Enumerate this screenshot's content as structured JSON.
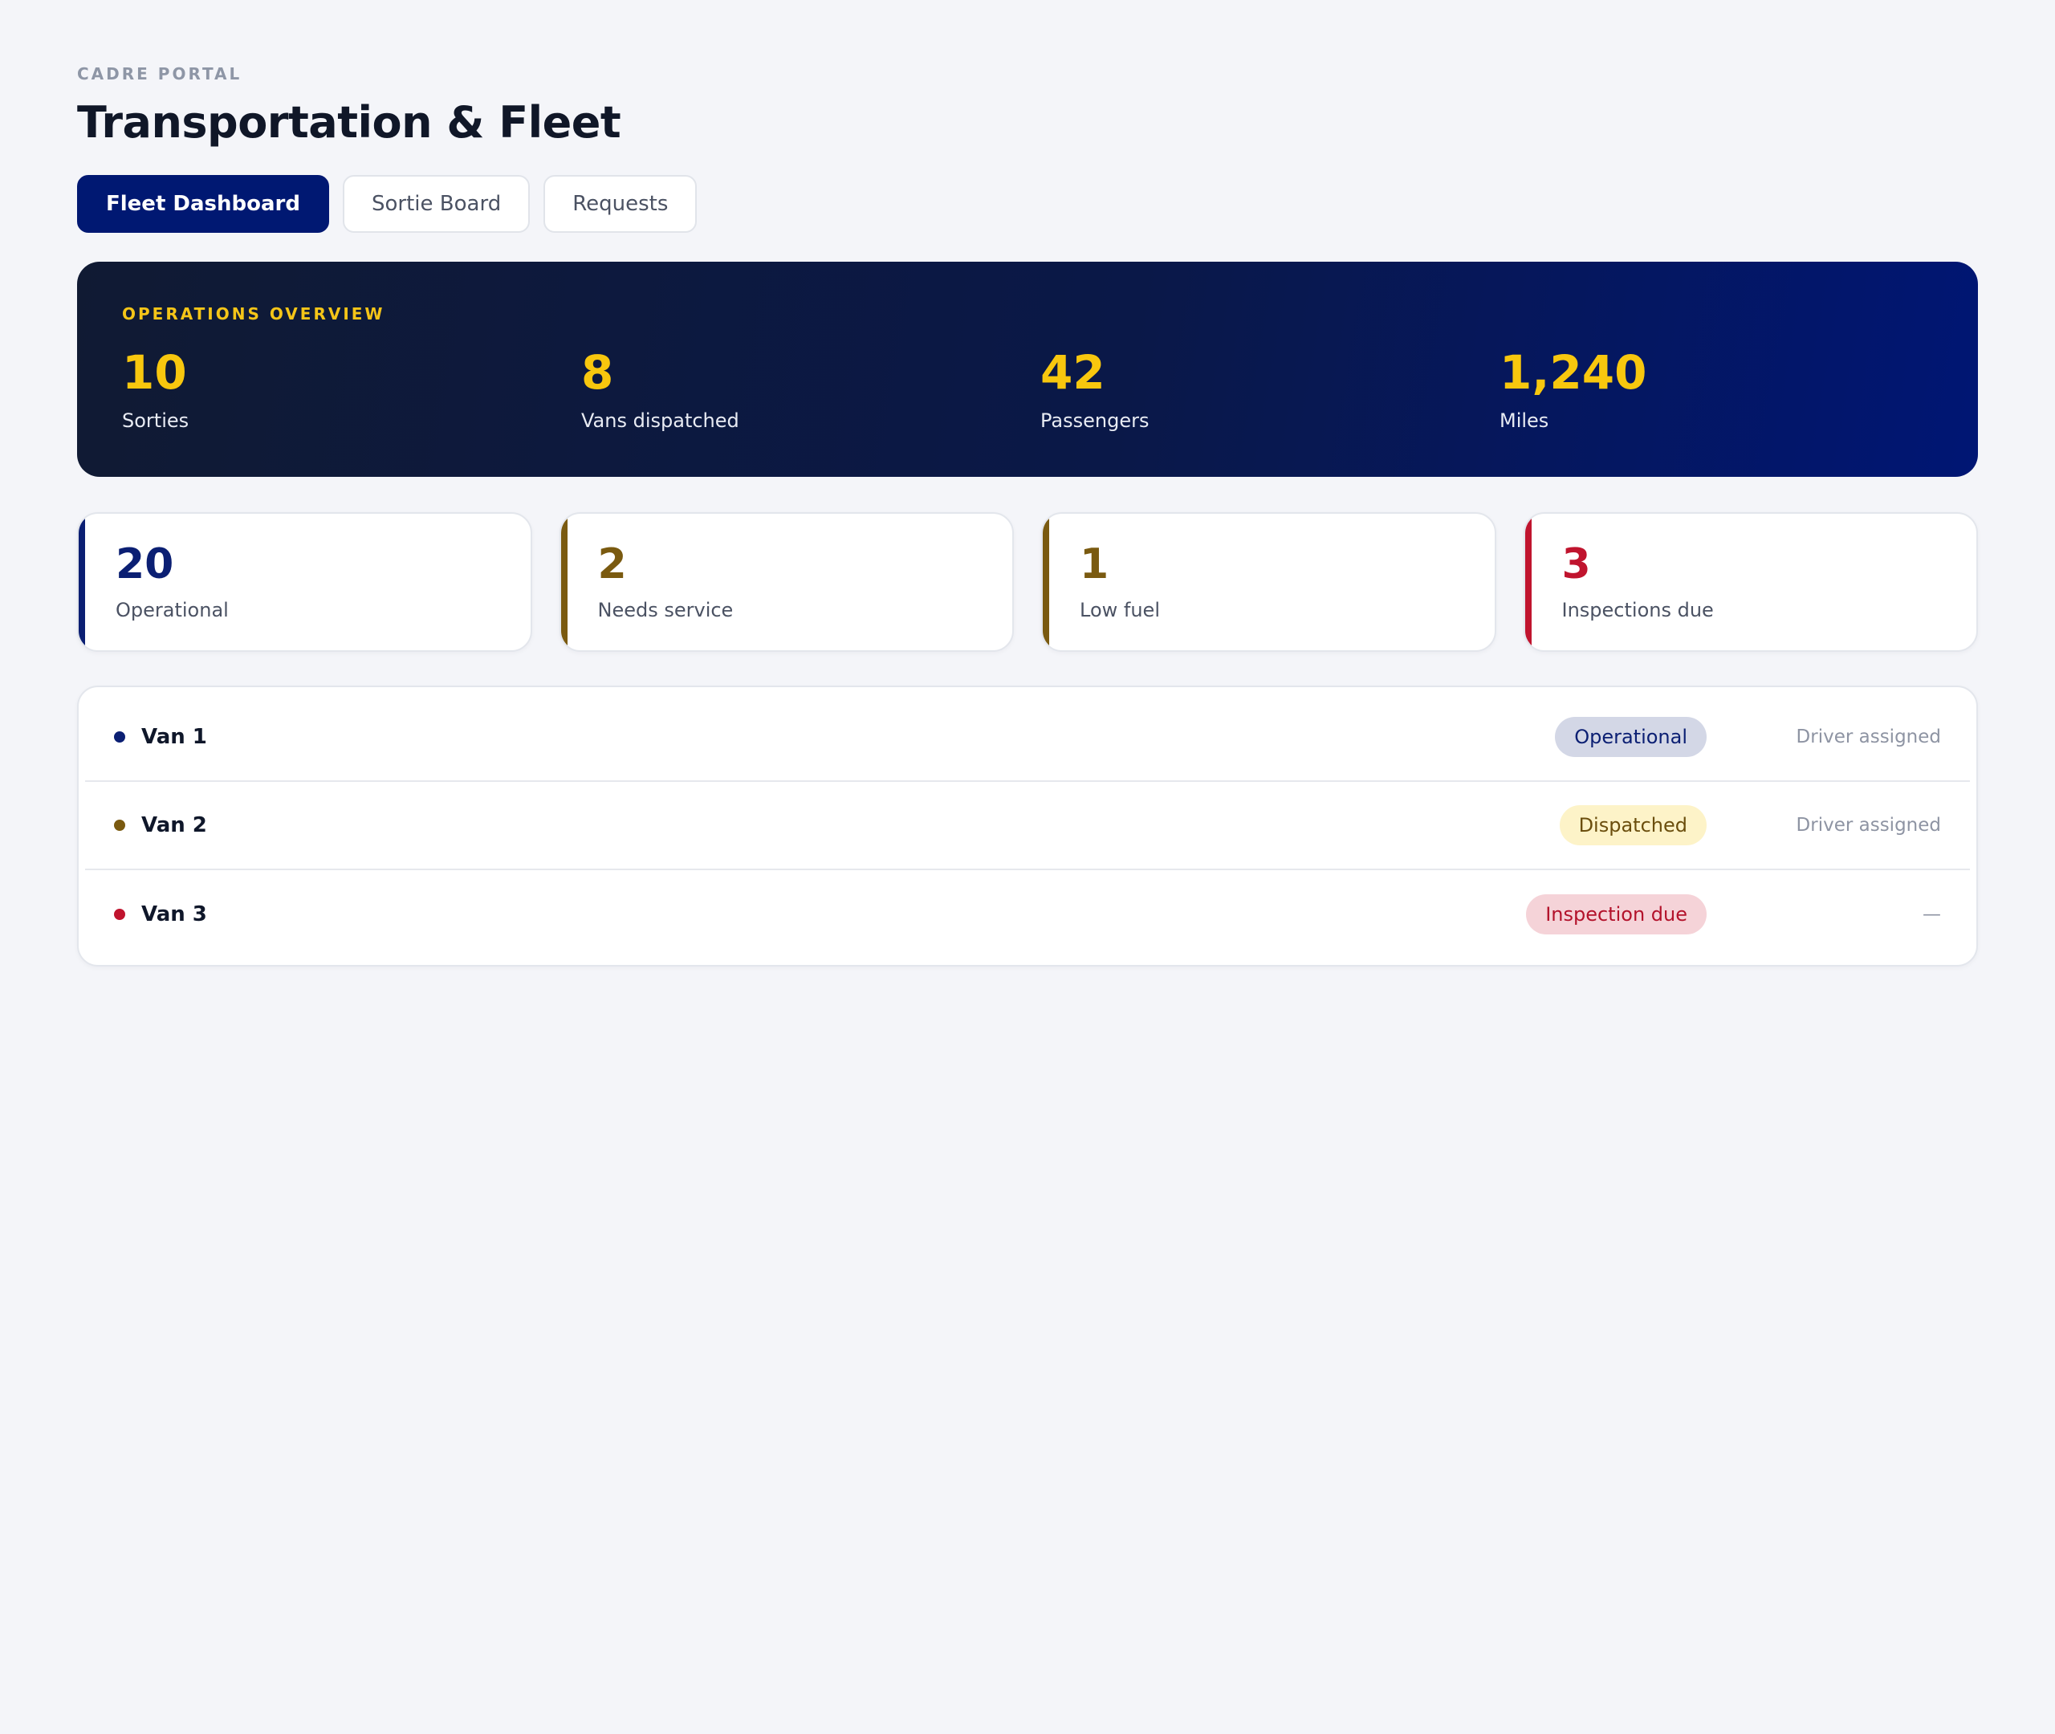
{
  "header": {
    "eyebrow": "CADRE PORTAL",
    "title": "Transportation & Fleet"
  },
  "tabs": [
    {
      "label": "Fleet Dashboard",
      "active": true
    },
    {
      "label": "Sortie Board",
      "active": false
    },
    {
      "label": "Requests",
      "active": false
    }
  ],
  "overview": {
    "label": "OPERATIONS OVERVIEW",
    "stats": [
      {
        "value": "10",
        "label": "Sorties"
      },
      {
        "value": "8",
        "label": "Vans dispatched"
      },
      {
        "value": "42",
        "label": "Passengers"
      },
      {
        "value": "1,240",
        "label": "Miles"
      }
    ]
  },
  "metrics": [
    {
      "value": "20",
      "label": "Operational",
      "color": "#0b1f73"
    },
    {
      "value": "2",
      "label": "Needs service",
      "color": "#7a5a10"
    },
    {
      "value": "1",
      "label": "Low fuel",
      "color": "#7a5a10"
    },
    {
      "value": "3",
      "label": "Inspections due",
      "color": "#c0142e"
    }
  ],
  "fleet": [
    {
      "name": "Van 1",
      "status": "Operational",
      "driver": "Driver assigned",
      "dot_color": "#0b1f73",
      "badge_bg": "#d3d7e6",
      "badge_fg": "#0b1f73"
    },
    {
      "name": "Van 2",
      "status": "Dispatched",
      "driver": "Driver assigned",
      "dot_color": "#7a5a10",
      "badge_bg": "#fdf3c8",
      "badge_fg": "#6b4e0d"
    },
    {
      "name": "Van 3",
      "status": "Inspection due",
      "driver": "—",
      "dot_color": "#c0142e",
      "badge_bg": "#f5d3d8",
      "badge_fg": "#b3122b"
    }
  ]
}
